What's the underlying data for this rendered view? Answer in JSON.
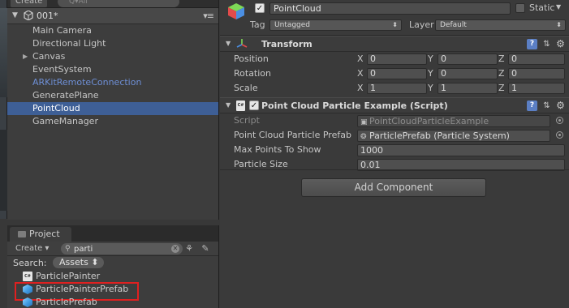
{
  "hierarchy": {
    "create_label": "Create",
    "search_placeholder": "Q▾All",
    "scene_name": "001*",
    "menu_glyph": "▾≡",
    "items": [
      {
        "label": "Main Camera"
      },
      {
        "label": "Directional Light"
      },
      {
        "label": "Canvas"
      },
      {
        "label": "EventSystem"
      },
      {
        "label": "ARKitRemoteConnection"
      },
      {
        "label": "GeneratePlane"
      },
      {
        "label": "PointCloud"
      },
      {
        "label": "GameManager"
      }
    ],
    "selected_item": "PointCloud",
    "prefab_item_color": "#6e8fd6",
    "selection_color": "#3e5f96"
  },
  "project": {
    "tab_label": "Project",
    "create_label": "Create",
    "search_value": "parti",
    "search_label": "Search:",
    "scope_label": "Assets",
    "assets": [
      {
        "label": "ParticlePainter",
        "icon": "cs-script-icon"
      },
      {
        "label": "ParticlePainterPrefab",
        "icon": "prefab-icon"
      },
      {
        "label": "ParticlePrefab",
        "icon": "prefab-icon"
      }
    ],
    "highlighted_asset": "ParticlePainterPrefab",
    "highlight_color": "#e02020"
  },
  "inspector": {
    "object_name": "PointCloud",
    "static_label": "Static",
    "tag_label": "Tag",
    "tag_value": "Untagged",
    "layer_label": "Layer",
    "layer_value": "Default",
    "transform": {
      "title": "Transform",
      "position_label": "Position",
      "rotation_label": "Rotation",
      "scale_label": "Scale",
      "axes": [
        "X",
        "Y",
        "Z"
      ],
      "position": [
        "0",
        "0",
        "0"
      ],
      "rotation": [
        "0",
        "0",
        "0"
      ],
      "scale": [
        "1",
        "1",
        "1"
      ]
    },
    "script_component": {
      "title": "Point Cloud Particle Example (Script)",
      "script_label": "Script",
      "script_value": "PointCloudParticleExample",
      "prefab_label": "Point Cloud Particle Prefab",
      "prefab_value": "ParticlePrefab (Particle System)",
      "max_points_label": "Max Points To Show",
      "max_points_value": "1000",
      "particle_size_label": "Particle Size",
      "particle_size_value": "0.01"
    },
    "add_component_label": "Add Component"
  }
}
